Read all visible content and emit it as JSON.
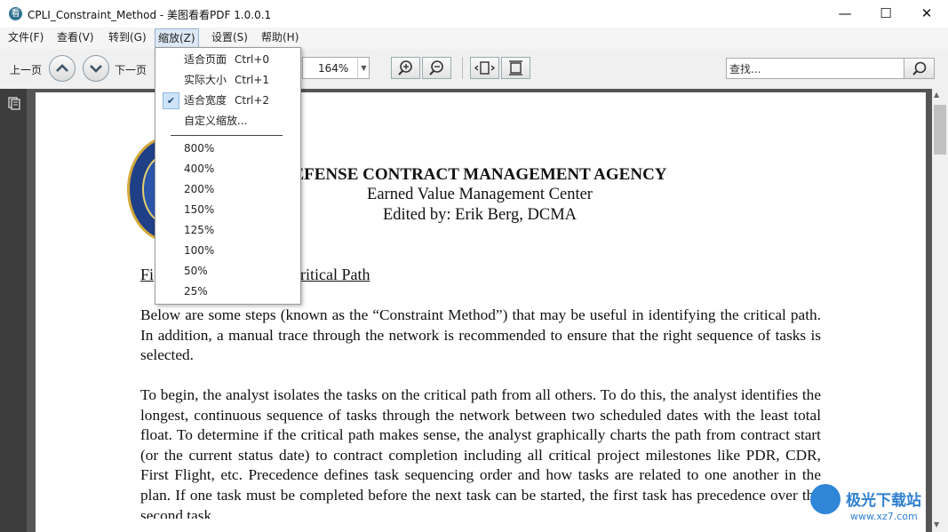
{
  "window": {
    "title": "CPLI_Constraint_Method - 美图看看PDF 1.0.0.1",
    "app_icon_glyph": "看",
    "minimize": "—",
    "maximize": "☐",
    "close": "✕"
  },
  "menubar": {
    "items": [
      "文件(F)",
      "查看(V)",
      "转到(G)",
      "缩放(Z)",
      "设置(S)",
      "帮助(H)"
    ]
  },
  "toolbar": {
    "prev_label": "上一页",
    "next_label": "下一页",
    "zoom_value": "164%",
    "search_placeholder": "查找..."
  },
  "zoom_menu": {
    "items": [
      {
        "label": "适合页面",
        "shortcut": "Ctrl+0",
        "checked": false
      },
      {
        "label": "实际大小",
        "shortcut": "Ctrl+1",
        "checked": false
      },
      {
        "label": "适合宽度",
        "shortcut": "Ctrl+2",
        "checked": true
      },
      {
        "label": "自定义缩放...",
        "shortcut": "",
        "checked": false
      }
    ],
    "presets": [
      "800%",
      "400%",
      "200%",
      "150%",
      "125%",
      "100%",
      "50%",
      "25%"
    ],
    "check_glyph": "✔"
  },
  "document": {
    "agency": "EFENSE CONTRACT MANAGEMENT AGENCY",
    "center": "Earned Value Management Center",
    "editor": "Edited by: Erik Berg, DCMA",
    "heading_left": "Fi",
    "heading_right": "ritical Path",
    "para1": "Below are some steps (known as the “Constraint Method”) that may be useful in identifying the critical path. In addition, a manual trace through the network is recommended to ensure that the right sequence of tasks is selected.",
    "para2": "To begin, the analyst isolates the tasks on the critical path from all others. To do this, the analyst identifies the longest, continuous sequence of tasks through the network between two scheduled dates with the least total float. To determine if the critical path makes sense, the analyst graphically charts the path from contract start (or the current status date) to contract completion including all critical project milestones like PDR, CDR, First Flight, etc. Precedence defines task sequencing order and how tasks are related to one another in the plan. If one task must be completed before the next task can be started, the first task has precedence over the second task."
  },
  "watermark": {
    "text": "极光下载站",
    "url": "www.xz7.com"
  }
}
